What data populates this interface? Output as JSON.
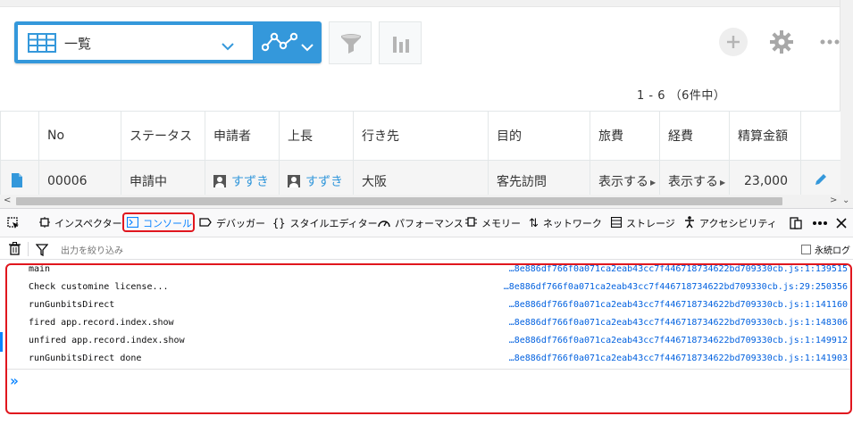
{
  "app": {
    "view_selector": {
      "label": "一覧"
    },
    "pagination": "1 - 6 （6件中）"
  },
  "table": {
    "headers": [
      "No",
      "ステータス",
      "申請者",
      "上長",
      "行き先",
      "目的",
      "旅費",
      "経費",
      "精算金額"
    ],
    "row": {
      "no": "00006",
      "status": "申請中",
      "applicant": "すずき",
      "boss": "すずき",
      "destination": "大阪",
      "purpose": "客先訪問",
      "travel_cost": "表示する",
      "expense": "表示する",
      "amount": "23,000"
    }
  },
  "devtools": {
    "tabs": [
      {
        "label": "インスペクター",
        "icon": "inspector-icon"
      },
      {
        "label": "コンソール",
        "icon": "console-icon",
        "active": true
      },
      {
        "label": "デバッガー",
        "icon": "debugger-icon"
      },
      {
        "label": "スタイルエディター",
        "icon": "style-editor-icon"
      },
      {
        "label": "パフォーマンス",
        "icon": "performance-icon"
      },
      {
        "label": "メモリー",
        "icon": "memory-icon"
      },
      {
        "label": "ネットワーク",
        "icon": "network-icon"
      },
      {
        "label": "ストレージ",
        "icon": "storage-icon"
      },
      {
        "label": "アクセシビリティ",
        "icon": "accessibility-icon"
      }
    ],
    "filter_placeholder": "出力を絞り込み",
    "persist_logs_label": "永続ログ",
    "logs": [
      {
        "message": "main",
        "location": "…8e886df766f0a071ca2eab43cc7f446718734622bd709330cb.js:1:139515"
      },
      {
        "message": "Check customine license...",
        "location": "…8e886df766f0a071ca2eab43cc7f446718734622bd709330cb.js:29:250356"
      },
      {
        "message": "runGunbitsDirect",
        "location": "…8e886df766f0a071ca2eab43cc7f446718734622bd709330cb.js:1:141160"
      },
      {
        "message": "fired app.record.index.show",
        "location": "…8e886df766f0a071ca2eab43cc7f446718734622bd709330cb.js:1:148306"
      },
      {
        "message": "unfired app.record.index.show",
        "location": "…8e886df766f0a071ca2eab43cc7f446718734622bd709330cb.js:1:149912"
      },
      {
        "message": "runGunbitsDirect done",
        "location": "…8e886df766f0a071ca2eab43cc7f446718734622bd709330cb.js:1:141903"
      }
    ],
    "prompt_symbol": "»"
  },
  "colors": {
    "accent_blue": "#3498db",
    "devtools_active": "#0a84ff",
    "highlight_red": "#e0161e",
    "link_blue": "#0060df"
  }
}
